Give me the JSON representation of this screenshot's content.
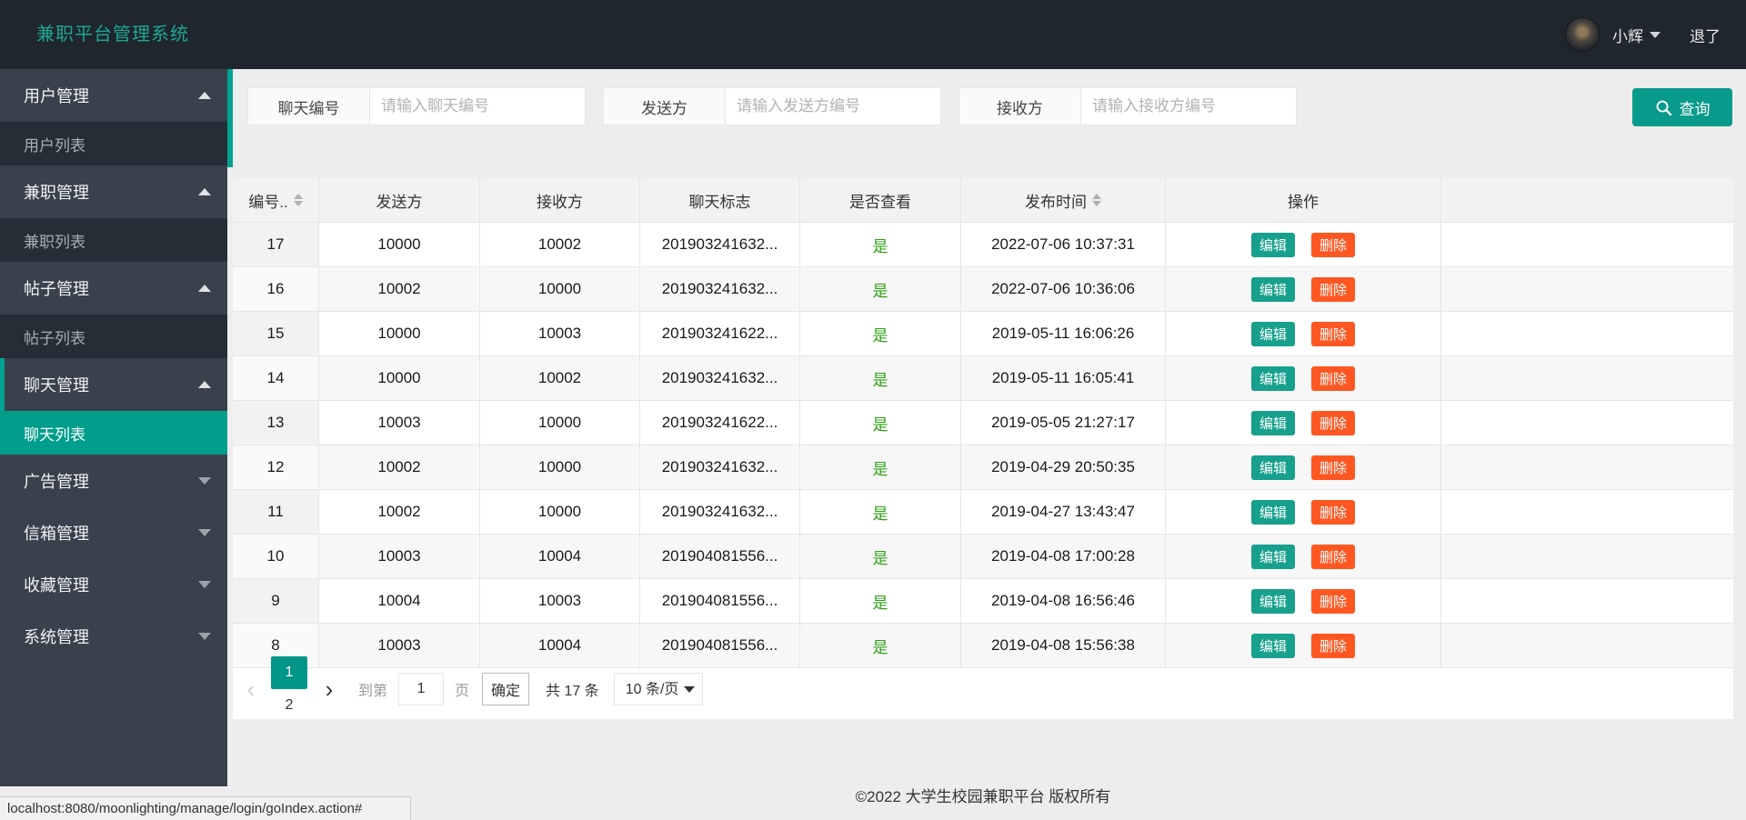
{
  "colors": {
    "accent_teal": "#009688",
    "sidebar_active": "#009e8b",
    "edit_button": "#17a08c",
    "delete_button": "#ff5722",
    "viewed_green": "#2fa015",
    "header_bg": "#1f262d",
    "title_teal": "#1ea592"
  },
  "header": {
    "title": "兼职平台管理系统",
    "user_name": "小辉",
    "logout_label": "退了"
  },
  "sidebar": {
    "groups": [
      {
        "label": "用户管理",
        "state": "expanded",
        "active": false,
        "children": [
          {
            "label": "用户列表",
            "active": false
          }
        ]
      },
      {
        "label": "兼职管理",
        "state": "expanded",
        "active": false,
        "children": [
          {
            "label": "兼职列表",
            "active": false
          }
        ]
      },
      {
        "label": "帖子管理",
        "state": "expanded",
        "active": false,
        "children": [
          {
            "label": "帖子列表",
            "active": false
          }
        ]
      },
      {
        "label": "聊天管理",
        "state": "expanded",
        "active": true,
        "children": [
          {
            "label": "聊天列表",
            "active": true
          }
        ]
      },
      {
        "label": "广告管理",
        "state": "collapsed",
        "active": false,
        "children": []
      },
      {
        "label": "信箱管理",
        "state": "collapsed",
        "active": false,
        "children": []
      },
      {
        "label": "收藏管理",
        "state": "collapsed",
        "active": false,
        "children": []
      },
      {
        "label": "系统管理",
        "state": "collapsed",
        "active": false,
        "children": []
      }
    ]
  },
  "filters": {
    "fields": [
      {
        "label": "聊天编号",
        "placeholder": "请输入聊天编号",
        "value": ""
      },
      {
        "label": "发送方",
        "placeholder": "请输入发送方编号",
        "value": ""
      },
      {
        "label": "接收方",
        "placeholder": "请输入接收方编号",
        "value": ""
      }
    ],
    "search_label": "查询"
  },
  "table": {
    "columns": [
      {
        "label": "编号..",
        "sortable": true
      },
      {
        "label": "发送方",
        "sortable": false
      },
      {
        "label": "接收方",
        "sortable": false
      },
      {
        "label": "聊天标志",
        "sortable": false
      },
      {
        "label": "是否查看",
        "sortable": false
      },
      {
        "label": "发布时间",
        "sortable": true
      },
      {
        "label": "操作",
        "sortable": false
      }
    ],
    "rows": [
      {
        "id": "17",
        "sender": "10000",
        "receiver": "10002",
        "flag": "201903241632...",
        "viewed": "是",
        "time": "2022-07-06 10:37:31"
      },
      {
        "id": "16",
        "sender": "10002",
        "receiver": "10000",
        "flag": "201903241632...",
        "viewed": "是",
        "time": "2022-07-06 10:36:06"
      },
      {
        "id": "15",
        "sender": "10000",
        "receiver": "10003",
        "flag": "201903241622...",
        "viewed": "是",
        "time": "2019-05-11 16:06:26"
      },
      {
        "id": "14",
        "sender": "10000",
        "receiver": "10002",
        "flag": "201903241632...",
        "viewed": "是",
        "time": "2019-05-11 16:05:41"
      },
      {
        "id": "13",
        "sender": "10003",
        "receiver": "10000",
        "flag": "201903241622...",
        "viewed": "是",
        "time": "2019-05-05 21:27:17"
      },
      {
        "id": "12",
        "sender": "10002",
        "receiver": "10000",
        "flag": "201903241632...",
        "viewed": "是",
        "time": "2019-04-29 20:50:35"
      },
      {
        "id": "11",
        "sender": "10002",
        "receiver": "10000",
        "flag": "201903241632...",
        "viewed": "是",
        "time": "2019-04-27 13:43:47"
      },
      {
        "id": "10",
        "sender": "10003",
        "receiver": "10004",
        "flag": "201904081556...",
        "viewed": "是",
        "time": "2019-04-08 17:00:28"
      },
      {
        "id": "9",
        "sender": "10004",
        "receiver": "10003",
        "flag": "201904081556...",
        "viewed": "是",
        "time": "2019-04-08 16:56:46"
      },
      {
        "id": "8",
        "sender": "10003",
        "receiver": "10004",
        "flag": "201904081556...",
        "viewed": "是",
        "time": "2019-04-08 15:56:38"
      }
    ],
    "edit_label": "编辑",
    "delete_label": "删除"
  },
  "pagination": {
    "prev_symbol": "‹",
    "next_symbol": "›",
    "pages": [
      "1",
      "2"
    ],
    "active_page": "1",
    "goto_label": "到第",
    "page_input_value": "1",
    "page_unit_label": "页",
    "confirm_label": "确定",
    "total_label": "共 17 条",
    "page_size_label": "10 条/页"
  },
  "footer": {
    "copyright": "©2022 大学生校园兼职平台 版权所有"
  },
  "status_bar": {
    "url": "localhost:8080/moonlighting/manage/login/goIndex.action#"
  }
}
